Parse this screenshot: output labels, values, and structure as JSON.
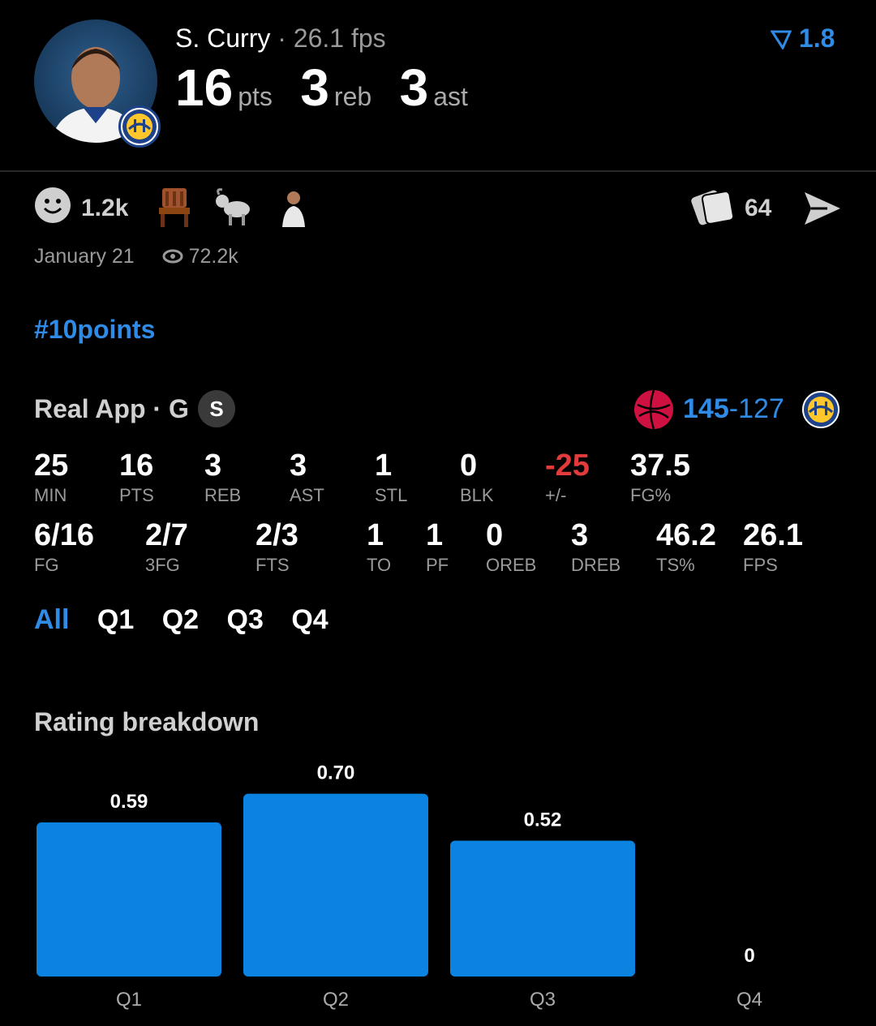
{
  "player": {
    "name": "S. Curry",
    "fps_text": "26.1 fps",
    "rating": "1.8",
    "pts": "16",
    "pts_unit": "pts",
    "reb": "3",
    "reb_unit": "reb",
    "ast": "3",
    "ast_unit": "ast"
  },
  "reactions": {
    "likes": "1.2k",
    "cards_count": "64",
    "date": "January 21",
    "views": "72.2k"
  },
  "hashtag": "#10points",
  "game": {
    "title": "Real App · G",
    "badge": "S",
    "score_team": "145",
    "score_sep": "-",
    "score_opp": "127"
  },
  "stats_row1": [
    {
      "value": "25",
      "label": "MIN"
    },
    {
      "value": "16",
      "label": "PTS"
    },
    {
      "value": "3",
      "label": "REB"
    },
    {
      "value": "3",
      "label": "AST"
    },
    {
      "value": "1",
      "label": "STL"
    },
    {
      "value": "0",
      "label": "BLK"
    },
    {
      "value": "-25",
      "label": "+/-"
    },
    {
      "value": "37.5",
      "label": "FG%"
    }
  ],
  "stats_row2": [
    {
      "value": "6/16",
      "label": "FG"
    },
    {
      "value": "2/7",
      "label": "3FG"
    },
    {
      "value": "2/3",
      "label": "FTS"
    },
    {
      "value": "1",
      "label": "TO"
    },
    {
      "value": "1",
      "label": "PF"
    },
    {
      "value": "0",
      "label": "OREB"
    },
    {
      "value": "3",
      "label": "DREB"
    },
    {
      "value": "46.2",
      "label": "TS%"
    },
    {
      "value": "26.1",
      "label": "FPS"
    }
  ],
  "tabs": [
    "All",
    "Q1",
    "Q2",
    "Q3",
    "Q4"
  ],
  "chart_data": {
    "type": "bar",
    "title": "Rating breakdown",
    "categories": [
      "Q1",
      "Q2",
      "Q3",
      "Q4"
    ],
    "values": [
      0.59,
      0.7,
      0.52,
      0
    ],
    "value_labels": [
      "0.59",
      "0.70",
      "0.52",
      "0"
    ],
    "color": "#0a84e0",
    "grid": false
  },
  "colors": {
    "accent": "#2f8be6",
    "negative": "#e23b3b",
    "bar": "#0a84e0"
  },
  "icons": [
    "smiley-icon",
    "chair-icon",
    "goat-icon",
    "player-sticker-icon",
    "cards-icon",
    "send-icon",
    "eye-icon",
    "raptors-logo-icon",
    "warriors-logo-icon",
    "rating-icon"
  ]
}
